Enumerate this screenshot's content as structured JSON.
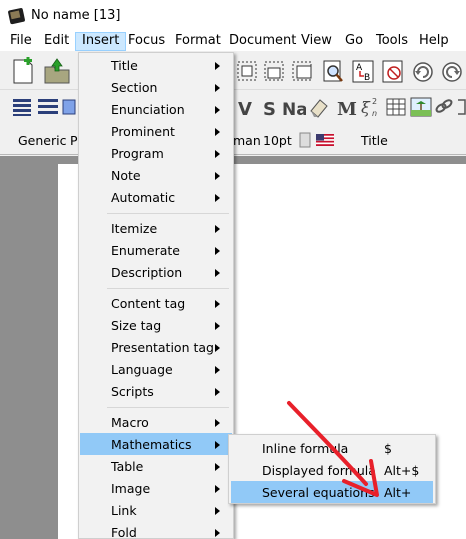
{
  "window": {
    "title": "No name [13]"
  },
  "menubar": {
    "items": [
      "File",
      "Edit",
      "Insert",
      "Focus",
      "Format",
      "Document",
      "View",
      "Go",
      "Tools",
      "Help"
    ],
    "active": "Insert"
  },
  "format_bar": {
    "style": "Generic",
    "style_partial": "P",
    "font_partial": "man",
    "font_size": "10pt",
    "language_flag": "us-flag-icon",
    "section": "Title"
  },
  "insert_menu": {
    "items": [
      "Title",
      "Section",
      "Enunciation",
      "Prominent",
      "Program",
      "Note",
      "Automatic",
      "Itemize",
      "Enumerate",
      "Description",
      "Content tag",
      "Size tag",
      "Presentation tag",
      "Language",
      "Scripts",
      "Macro",
      "Mathematics",
      "Table",
      "Image",
      "Link",
      "Fold"
    ],
    "highlighted": "Mathematics"
  },
  "mathematics_submenu": {
    "items": [
      {
        "label": "Inline formula",
        "shortcut": "$"
      },
      {
        "label": "Displayed formula",
        "shortcut": "Alt+$"
      },
      {
        "label": "Several equations",
        "shortcut": "Alt+"
      }
    ],
    "highlighted": "Several equations"
  },
  "toolbar_glyphs": {
    "v": "V",
    "s": "S",
    "na": "Na",
    "m": "M",
    "xi": "ξ",
    "xi_sup": "2",
    "xi_sub": "n",
    "sel_a": "A",
    "sel_b": "B"
  },
  "colors": {
    "menu_highlight": "#91c9f7",
    "active_menubar": "#cce8ff",
    "annotation_arrow": "#e8202a"
  }
}
